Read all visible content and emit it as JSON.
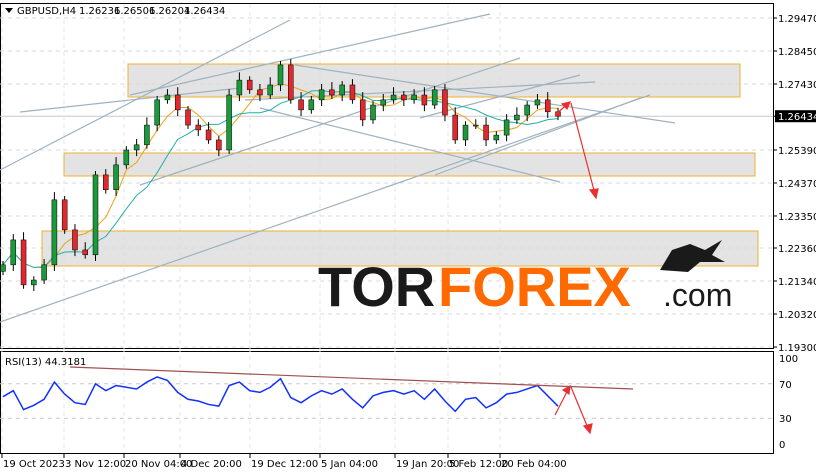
{
  "header": {
    "symbol_timeframe": "GBPUSD,H4",
    "open": "1.26236",
    "high": "1.26506",
    "low": "1.26204",
    "close": "1.26434"
  },
  "logo": {
    "text_dark": "TOR",
    "text_orange": "FOREX",
    "text_suffix": ".com"
  },
  "colors": {
    "up": "#1a9a3a",
    "down": "#e0282e",
    "ma_fast": "#e8a21a",
    "ma_slow": "#20b0a8",
    "rsi": "#1030ff",
    "zone_border": "#f0b030",
    "arrow": "#e83030"
  },
  "chart_data": [
    {
      "type": "candlestick",
      "title": "GBPUSD,H4",
      "ylim": [
        1.193,
        1.2947
      ],
      "y_ticks": [
        "1.29470",
        "1.28450",
        "1.27430",
        "1.26434",
        "1.25390",
        "1.24370",
        "1.23350",
        "1.22360",
        "1.21340",
        "1.20320",
        "1.19300"
      ],
      "current_price": "1.26434",
      "x_ticks": [
        "19 Oct 2023",
        "3 Nov 12:00",
        "20 Nov 04:00",
        "4 Dec 20:00",
        "19 Dec 12:00",
        "5 Jan 04:00",
        "19 Jan 20:00",
        "5 Feb 12:00",
        "20 Feb 04:00"
      ],
      "closes": [
        1.2184,
        1.2261,
        1.2122,
        1.2137,
        1.2184,
        1.2385,
        1.2292,
        1.223,
        1.2215,
        1.2462,
        1.2416,
        1.2493,
        1.2539,
        1.2555,
        1.2616,
        1.2694,
        1.2709,
        1.2663,
        1.2616,
        1.2601,
        1.257,
        1.2539,
        1.2709,
        1.2755,
        1.2725,
        1.2709,
        1.274,
        1.2802,
        1.2694,
        1.2663,
        1.2694,
        1.2725,
        1.2709,
        1.274,
        1.2694,
        1.2632,
        1.2678,
        1.2694,
        1.2709,
        1.2694,
        1.2709,
        1.2678,
        1.2725,
        1.2647,
        1.257,
        1.2616,
        1.2616,
        1.257,
        1.2585,
        1.2632,
        1.2647,
        1.2678,
        1.2694,
        1.2657,
        1.26434
      ]
    },
    {
      "type": "line",
      "title": "RSI(13) 44.3181",
      "ylim": [
        0,
        100
      ],
      "y_ticks": [
        "100",
        "70",
        "30",
        "0"
      ],
      "values": [
        55,
        62,
        40,
        45,
        52,
        72,
        58,
        48,
        46,
        70,
        62,
        68,
        66,
        64,
        72,
        78,
        74,
        60,
        52,
        50,
        46,
        44,
        68,
        72,
        62,
        60,
        66,
        76,
        54,
        48,
        56,
        62,
        58,
        64,
        52,
        42,
        56,
        60,
        62,
        58,
        62,
        52,
        64,
        50,
        38,
        52,
        54,
        42,
        48,
        58,
        60,
        64,
        68,
        56,
        44
      ]
    }
  ]
}
